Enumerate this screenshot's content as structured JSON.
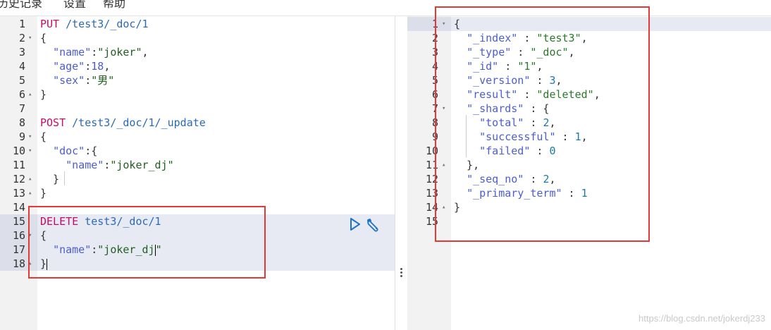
{
  "menu": {
    "items": [
      {
        "label": "历史记录"
      },
      {
        "label": "设置"
      },
      {
        "label": "帮助"
      }
    ]
  },
  "request_editor": {
    "lines": [
      {
        "num": "1",
        "fold": "",
        "text": [
          [
            "tok-method",
            "PUT"
          ],
          [
            "tok-url",
            " /test3/_doc/1"
          ]
        ]
      },
      {
        "num": "2",
        "fold": "▾",
        "text": [
          [
            "tok-punc",
            "{"
          ]
        ]
      },
      {
        "num": "3",
        "fold": "",
        "text": [
          [
            "tok-punc",
            "  "
          ],
          [
            "tok-key",
            "\"name\""
          ],
          [
            "tok-punc",
            ":"
          ],
          [
            "tok-str",
            "\"joker\""
          ],
          [
            "tok-punc",
            ","
          ]
        ]
      },
      {
        "num": "4",
        "fold": "",
        "text": [
          [
            "tok-punc",
            "  "
          ],
          [
            "tok-key",
            "\"age\""
          ],
          [
            "tok-punc",
            ":"
          ],
          [
            "tok-num",
            "18"
          ],
          [
            "tok-punc",
            ","
          ]
        ]
      },
      {
        "num": "5",
        "fold": "",
        "text": [
          [
            "tok-punc",
            "  "
          ],
          [
            "tok-key",
            "\"sex\""
          ],
          [
            "tok-punc",
            ":"
          ],
          [
            "tok-str",
            "\"男\""
          ]
        ]
      },
      {
        "num": "6",
        "fold": "▴",
        "text": [
          [
            "tok-punc",
            "}"
          ]
        ]
      },
      {
        "num": "7",
        "fold": "",
        "text": []
      },
      {
        "num": "8",
        "fold": "",
        "text": [
          [
            "tok-method",
            "POST"
          ],
          [
            "tok-url",
            " /test3/_doc/1/_update"
          ]
        ]
      },
      {
        "num": "9",
        "fold": "▾",
        "text": [
          [
            "tok-punc",
            "{"
          ]
        ]
      },
      {
        "num": "10",
        "fold": "▾",
        "text": [
          [
            "tok-punc",
            "  "
          ],
          [
            "tok-key",
            "\"doc\""
          ],
          [
            "tok-punc",
            ":{"
          ]
        ]
      },
      {
        "num": "11",
        "fold": "",
        "text": [
          [
            "tok-punc",
            "    "
          ],
          [
            "tok-key",
            "\"name\""
          ],
          [
            "tok-punc",
            ":"
          ],
          [
            "tok-str",
            "\"joker_dj\""
          ]
        ]
      },
      {
        "num": "12",
        "fold": "▴",
        "text": [
          [
            "tok-punc",
            "  }"
          ]
        ]
      },
      {
        "num": "13",
        "fold": "▴",
        "text": [
          [
            "tok-punc",
            "}"
          ]
        ]
      },
      {
        "num": "14",
        "fold": "",
        "text": []
      },
      {
        "num": "15",
        "fold": "",
        "text": [
          [
            "tok-method",
            "DELETE"
          ],
          [
            "tok-url",
            " test3/_doc/1"
          ]
        ],
        "highlight": true
      },
      {
        "num": "16",
        "fold": "▾",
        "text": [
          [
            "tok-punc",
            "{"
          ]
        ],
        "highlight": true
      },
      {
        "num": "17",
        "fold": "",
        "text": [
          [
            "tok-punc",
            "  "
          ],
          [
            "tok-key",
            "\"name\""
          ],
          [
            "tok-punc",
            ":"
          ],
          [
            "tok-str",
            "\"joker_dj"
          ],
          [
            "cursor",
            ""
          ],
          [
            "tok-str",
            "\""
          ]
        ],
        "highlight": true
      },
      {
        "num": "18",
        "fold": "▴",
        "text": [
          [
            "tok-punc",
            "}"
          ],
          [
            "cursor",
            ""
          ]
        ],
        "highlight": true,
        "current": true
      }
    ],
    "actions": {
      "run": {
        "icon": "play-icon",
        "color": "#1a73c8"
      },
      "settings": {
        "icon": "wrench-icon",
        "color": "#1a73c8"
      }
    }
  },
  "response_viewer": {
    "lines": [
      {
        "num": "1",
        "fold": "▾",
        "text": [
          [
            "tok-punc",
            "{"
          ]
        ],
        "highlight": true
      },
      {
        "num": "2",
        "fold": "",
        "text": [
          [
            "tok-punc",
            "  "
          ],
          [
            "tok-key",
            "\"_index\""
          ],
          [
            "tok-punc",
            " : "
          ],
          [
            "tok-str-r",
            "\"test3\""
          ],
          [
            "tok-punc",
            ","
          ]
        ]
      },
      {
        "num": "3",
        "fold": "",
        "text": [
          [
            "tok-punc",
            "  "
          ],
          [
            "tok-key",
            "\"_type\""
          ],
          [
            "tok-punc",
            " : "
          ],
          [
            "tok-str-r",
            "\"_doc\""
          ],
          [
            "tok-punc",
            ","
          ]
        ]
      },
      {
        "num": "4",
        "fold": "",
        "text": [
          [
            "tok-punc",
            "  "
          ],
          [
            "tok-key",
            "\"_id\""
          ],
          [
            "tok-punc",
            " : "
          ],
          [
            "tok-str-r",
            "\"1\""
          ],
          [
            "tok-punc",
            ","
          ]
        ]
      },
      {
        "num": "5",
        "fold": "",
        "text": [
          [
            "tok-punc",
            "  "
          ],
          [
            "tok-key",
            "\"_version\""
          ],
          [
            "tok-punc",
            " : "
          ],
          [
            "tok-num-r",
            "3"
          ],
          [
            "tok-punc",
            ","
          ]
        ]
      },
      {
        "num": "6",
        "fold": "",
        "text": [
          [
            "tok-punc",
            "  "
          ],
          [
            "tok-key",
            "\"result\""
          ],
          [
            "tok-punc",
            " : "
          ],
          [
            "tok-str-r",
            "\"deleted\""
          ],
          [
            "tok-punc",
            ","
          ]
        ]
      },
      {
        "num": "7",
        "fold": "▾",
        "text": [
          [
            "tok-punc",
            "  "
          ],
          [
            "tok-key",
            "\"_shards\""
          ],
          [
            "tok-punc",
            " : {"
          ]
        ]
      },
      {
        "num": "8",
        "fold": "",
        "text": [
          [
            "tok-punc",
            "    "
          ],
          [
            "tok-key",
            "\"total\""
          ],
          [
            "tok-punc",
            " : "
          ],
          [
            "tok-num-r",
            "2"
          ],
          [
            "tok-punc",
            ","
          ]
        ]
      },
      {
        "num": "9",
        "fold": "",
        "text": [
          [
            "tok-punc",
            "    "
          ],
          [
            "tok-key",
            "\"successful\""
          ],
          [
            "tok-punc",
            " : "
          ],
          [
            "tok-num-r",
            "1"
          ],
          [
            "tok-punc",
            ","
          ]
        ]
      },
      {
        "num": "10",
        "fold": "",
        "text": [
          [
            "tok-punc",
            "    "
          ],
          [
            "tok-key",
            "\"failed\""
          ],
          [
            "tok-punc",
            " : "
          ],
          [
            "tok-num-r",
            "0"
          ]
        ]
      },
      {
        "num": "11",
        "fold": "▴",
        "text": [
          [
            "tok-punc",
            "  },"
          ]
        ]
      },
      {
        "num": "12",
        "fold": "",
        "text": [
          [
            "tok-punc",
            "  "
          ],
          [
            "tok-key",
            "\"_seq_no\""
          ],
          [
            "tok-punc",
            " : "
          ],
          [
            "tok-num-r",
            "2"
          ],
          [
            "tok-punc",
            ","
          ]
        ]
      },
      {
        "num": "13",
        "fold": "",
        "text": [
          [
            "tok-punc",
            "  "
          ],
          [
            "tok-key",
            "\"_primary_term\""
          ],
          [
            "tok-punc",
            " : "
          ],
          [
            "tok-num-r",
            "1"
          ]
        ]
      },
      {
        "num": "14",
        "fold": "▴",
        "text": [
          [
            "tok-punc",
            "}"
          ]
        ]
      },
      {
        "num": "15",
        "fold": "",
        "text": []
      }
    ]
  },
  "annotations": {
    "color": "#e53935"
  },
  "watermark": "https://blog.csdn.net/jokerdj233"
}
